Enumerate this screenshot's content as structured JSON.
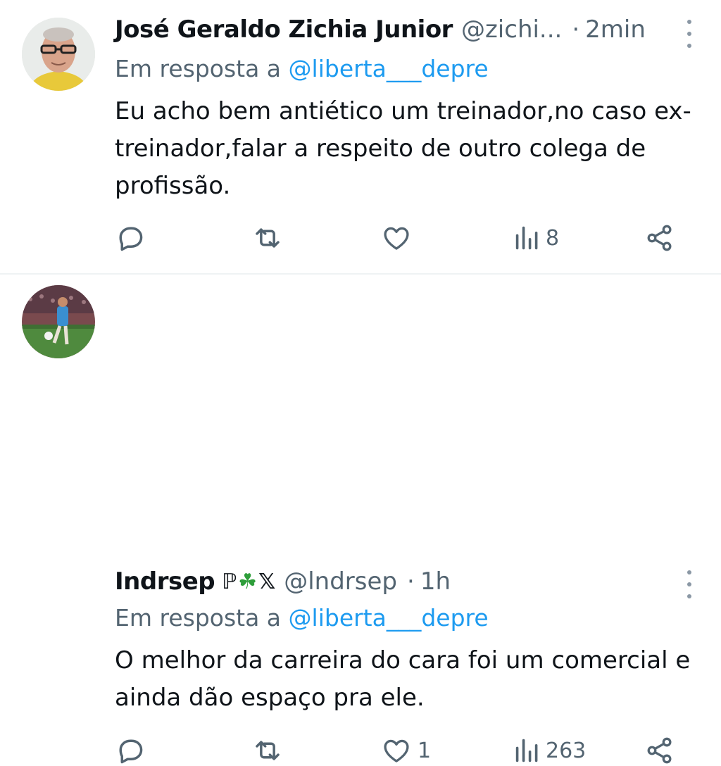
{
  "tweets": [
    {
      "name": "José Geraldo Zichia Junior",
      "handle": "@zichi...",
      "separator": "·",
      "time": "2min",
      "reply_prefix": "Em resposta a",
      "reply_to": "@liberta___depre",
      "text": "Eu acho bem antiético um treinador,no caso ex-treinador,falar a respeito de outro colega de profissão.",
      "likes": "",
      "views": "8",
      "avatar": "person-with-glasses-photo"
    },
    {
      "name": "Indrsep",
      "badges": [
        "ℙ",
        "☘",
        "𝕏"
      ],
      "handle": "@lndrsep",
      "separator": "·",
      "time": "1h",
      "reply_prefix": "Em resposta a",
      "reply_to": "@liberta___depre",
      "text": "O melhor da carreira do cara foi um comercial e ainda dão espaço pra ele.",
      "likes": "1",
      "views": "263",
      "avatar": "football-player-photo"
    }
  ],
  "colors": {
    "text": "#0f1419",
    "secondary": "#536471",
    "link": "#1d9bf0",
    "divider": "#eff3f4"
  }
}
